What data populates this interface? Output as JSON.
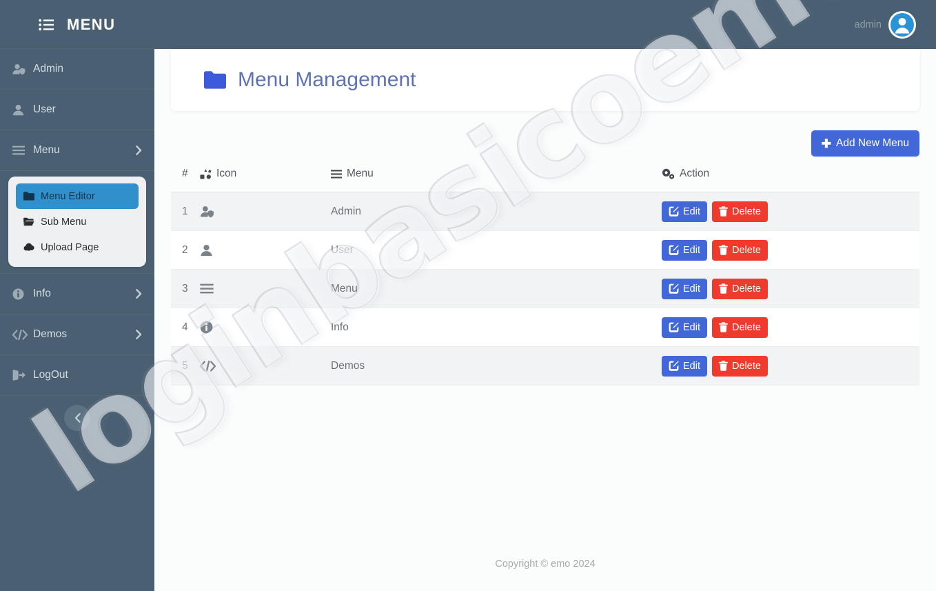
{
  "topbar": {
    "menu_toggle_icon": "list-ul-icon",
    "brand": "MENU",
    "admin_label": "admin",
    "avatar_icon": "user-circle-avatar-icon"
  },
  "sidebar": {
    "items": [
      {
        "label": "Admin",
        "icon": "user-shield-icon",
        "has_chevron": false
      },
      {
        "label": "User",
        "icon": "user-icon",
        "has_chevron": false
      },
      {
        "label": "Menu",
        "icon": "bars-icon",
        "has_chevron": true
      },
      {
        "label": "Info",
        "icon": "info-circle-icon",
        "has_chevron": true
      },
      {
        "label": "Demos",
        "icon": "code-icon",
        "has_chevron": true
      },
      {
        "label": "LogOut",
        "icon": "sign-out-icon",
        "has_chevron": false
      }
    ],
    "submenu": [
      {
        "label": "Menu Editor",
        "icon": "folder-icon",
        "active": true
      },
      {
        "label": "Sub Menu",
        "icon": "folder-open-icon",
        "active": false
      },
      {
        "label": "Upload Page",
        "icon": "cloud-upload-icon",
        "active": false
      }
    ],
    "collapse_icon": "chevron-left-icon"
  },
  "main": {
    "page_title": "Menu Management",
    "page_title_icon": "folder-icon",
    "add_button": "Add New Menu",
    "add_button_icon": "plus-icon",
    "table": {
      "headers": [
        {
          "label": "#",
          "icon": null
        },
        {
          "label": "Icon",
          "icon": "icons-icon"
        },
        {
          "label": "Menu",
          "icon": "bars-icon"
        },
        {
          "label": "Action",
          "icon": "cogs-icon"
        }
      ],
      "rows": [
        {
          "num": "1",
          "icon": "user-shield-icon",
          "menu": "Admin",
          "edit": "Edit",
          "delete": "Delete"
        },
        {
          "num": "2",
          "icon": "user-icon",
          "menu": "User",
          "edit": "Edit",
          "delete": "Delete"
        },
        {
          "num": "3",
          "icon": "bars-icon",
          "menu": "Menu",
          "edit": "Edit",
          "delete": "Delete"
        },
        {
          "num": "4",
          "icon": "info-circle-icon",
          "menu": "Info",
          "edit": "Edit",
          "delete": "Delete"
        },
        {
          "num": "5",
          "icon": "code-icon",
          "menu": "Demos",
          "edit": "Edit",
          "delete": "Delete"
        }
      ]
    },
    "footer": "Copyright © emo 2024"
  },
  "watermark": {
    "text": "loginbasicoemo.com"
  },
  "colors": {
    "sidebar": "#4a6072",
    "accent_blue": "#4268d8",
    "danger_red": "#ef3b2d",
    "active_submenu": "#3190cb",
    "title_blue": "#5f72b5",
    "folder_blue": "#3b5bdb"
  }
}
